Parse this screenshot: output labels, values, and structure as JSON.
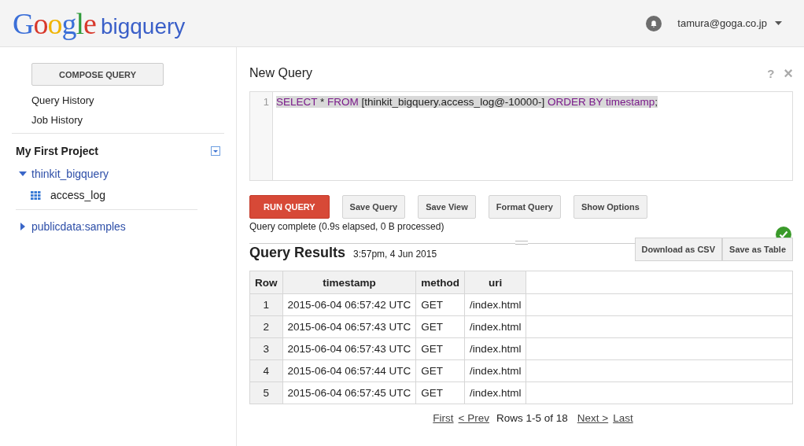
{
  "header": {
    "logo": "Google",
    "product": "bigquery",
    "user": "tamura@goga.co.jp"
  },
  "sidebar": {
    "compose_button": "COMPOSE QUERY",
    "links": [
      "Query History",
      "Job History"
    ],
    "project": "My First Project",
    "tree": [
      {
        "name": "thinkit_bigquery",
        "expanded": true,
        "children": [
          {
            "name": "access_log",
            "kind": "table"
          }
        ]
      },
      {
        "name": "publicdata:samples",
        "expanded": false
      }
    ]
  },
  "editor": {
    "title": "New Query",
    "help": "?",
    "close": "×",
    "lines": [
      {
        "number": "1",
        "selected": true,
        "tokens": [
          {
            "text": "SELECT",
            "kind": "keyword"
          },
          {
            "text": " * ",
            "kind": "plain"
          },
          {
            "text": "FROM",
            "kind": "keyword"
          },
          {
            "text": " [thinkit_bigquery.access_log@-10000-] ",
            "kind": "plain"
          },
          {
            "text": "ORDER BY timestamp",
            "kind": "keyword"
          },
          {
            "text": ";",
            "kind": "plain"
          }
        ]
      }
    ]
  },
  "buttons": [
    {
      "label": "RUN QUERY",
      "kind": "primary"
    },
    {
      "label": "Save Query",
      "kind": "normal"
    },
    {
      "label": "Save View",
      "kind": "normal"
    },
    {
      "label": "Format Query",
      "kind": "normal"
    },
    {
      "label": "Show Options",
      "kind": "normal"
    }
  ],
  "status": {
    "text": "Query complete (0.9s elapsed, 0 B processed)",
    "success": true
  },
  "results": {
    "title": "Query Results",
    "time": "3:57pm, 4 Jun 2015",
    "actions": [
      "Download as CSV",
      "Save as Table"
    ],
    "table": {
      "columns": [
        "Row",
        "timestamp",
        "method",
        "uri"
      ],
      "rows": [
        [
          "1",
          "2015-06-04 06:57:42 UTC",
          "GET",
          "/index.html"
        ],
        [
          "2",
          "2015-06-04 06:57:43 UTC",
          "GET",
          "/index.html"
        ],
        [
          "3",
          "2015-06-04 06:57:43 UTC",
          "GET",
          "/index.html"
        ],
        [
          "4",
          "2015-06-04 06:57:44 UTC",
          "GET",
          "/index.html"
        ],
        [
          "5",
          "2015-06-04 06:57:45 UTC",
          "GET",
          "/index.html"
        ]
      ]
    },
    "pager": {
      "first": "First",
      "prev": "< Prev",
      "info": "Rows 1-5 of 18",
      "next": "Next >",
      "last": "Last"
    }
  }
}
